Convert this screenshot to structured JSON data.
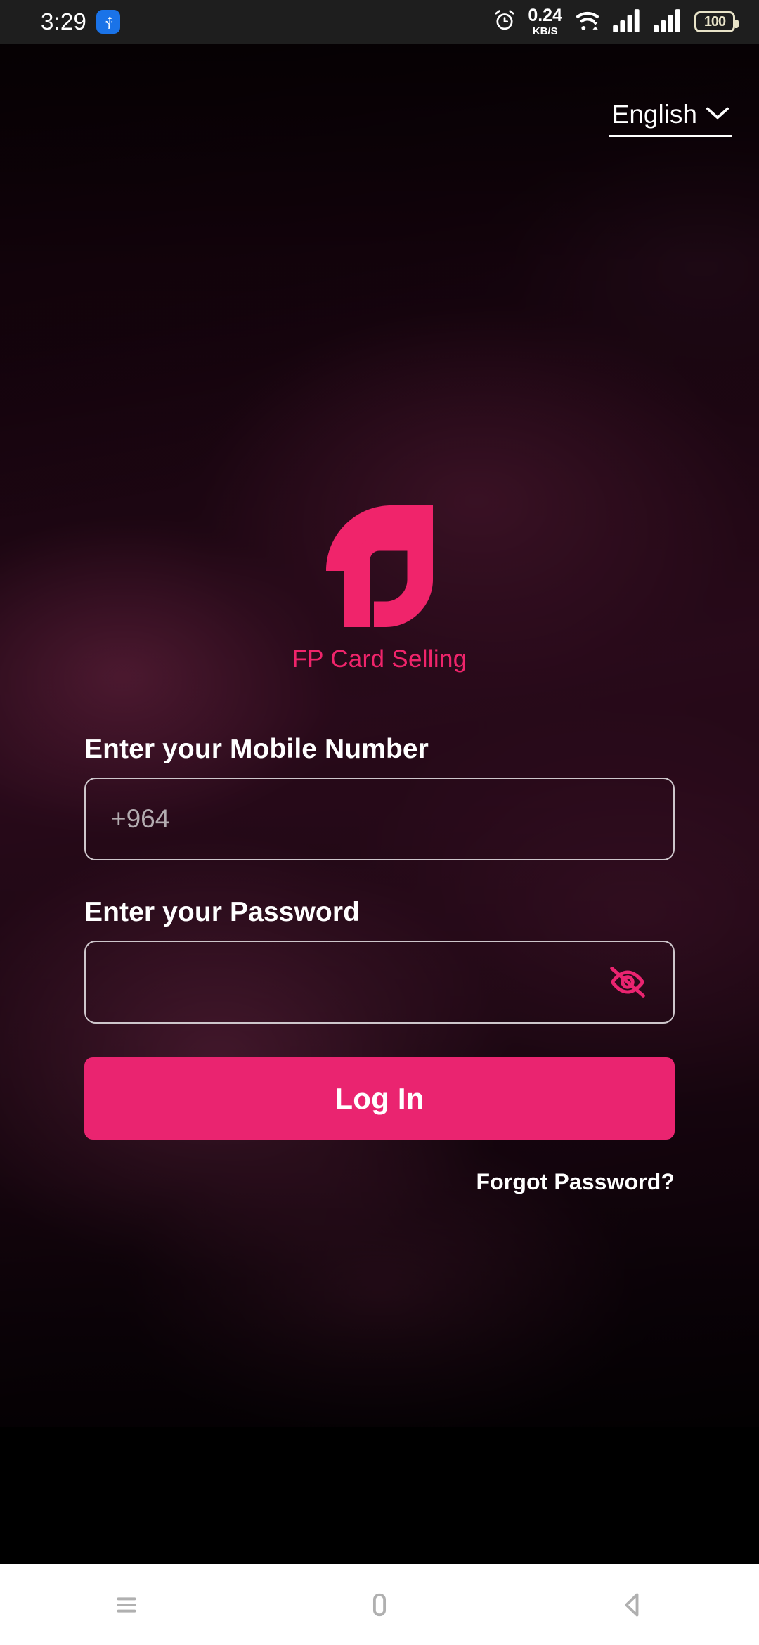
{
  "status_bar": {
    "time": "3:29",
    "usb_icon": "usb-icon",
    "alarm_icon": "alarm-icon",
    "network_speed_value": "0.24",
    "network_speed_unit": "KB/S",
    "wifi_icon": "wifi-icon",
    "signal_icon_1": "signal-bars-icon",
    "signal_icon_2": "signal-bars-icon",
    "battery_level": "100"
  },
  "language": {
    "selected": "English",
    "chevron_icon": "chevron-down-icon"
  },
  "brand": {
    "logo_icon": "fp-logo-icon",
    "name": "FP Card Selling"
  },
  "form": {
    "mobile_label": "Enter your Mobile Number",
    "mobile_placeholder": "+964",
    "mobile_value": "",
    "password_label": "Enter your Password",
    "password_placeholder": "",
    "password_value": "",
    "password_toggle_icon": "eye-off-icon",
    "login_label": "Log In",
    "forgot_password_label": "Forgot Password?"
  },
  "nav_bar": {
    "recents_icon": "recents-menu-icon",
    "home_icon": "home-icon",
    "back_icon": "back-icon"
  },
  "colors": {
    "accent_pink": "#ea2470",
    "logo_pink": "#f0246b",
    "status_bar_bg": "#1e1e1e",
    "battery_outline": "#e8e3c8",
    "input_border": "#cdc6cb",
    "nav_bar_bg": "#ffffff"
  }
}
